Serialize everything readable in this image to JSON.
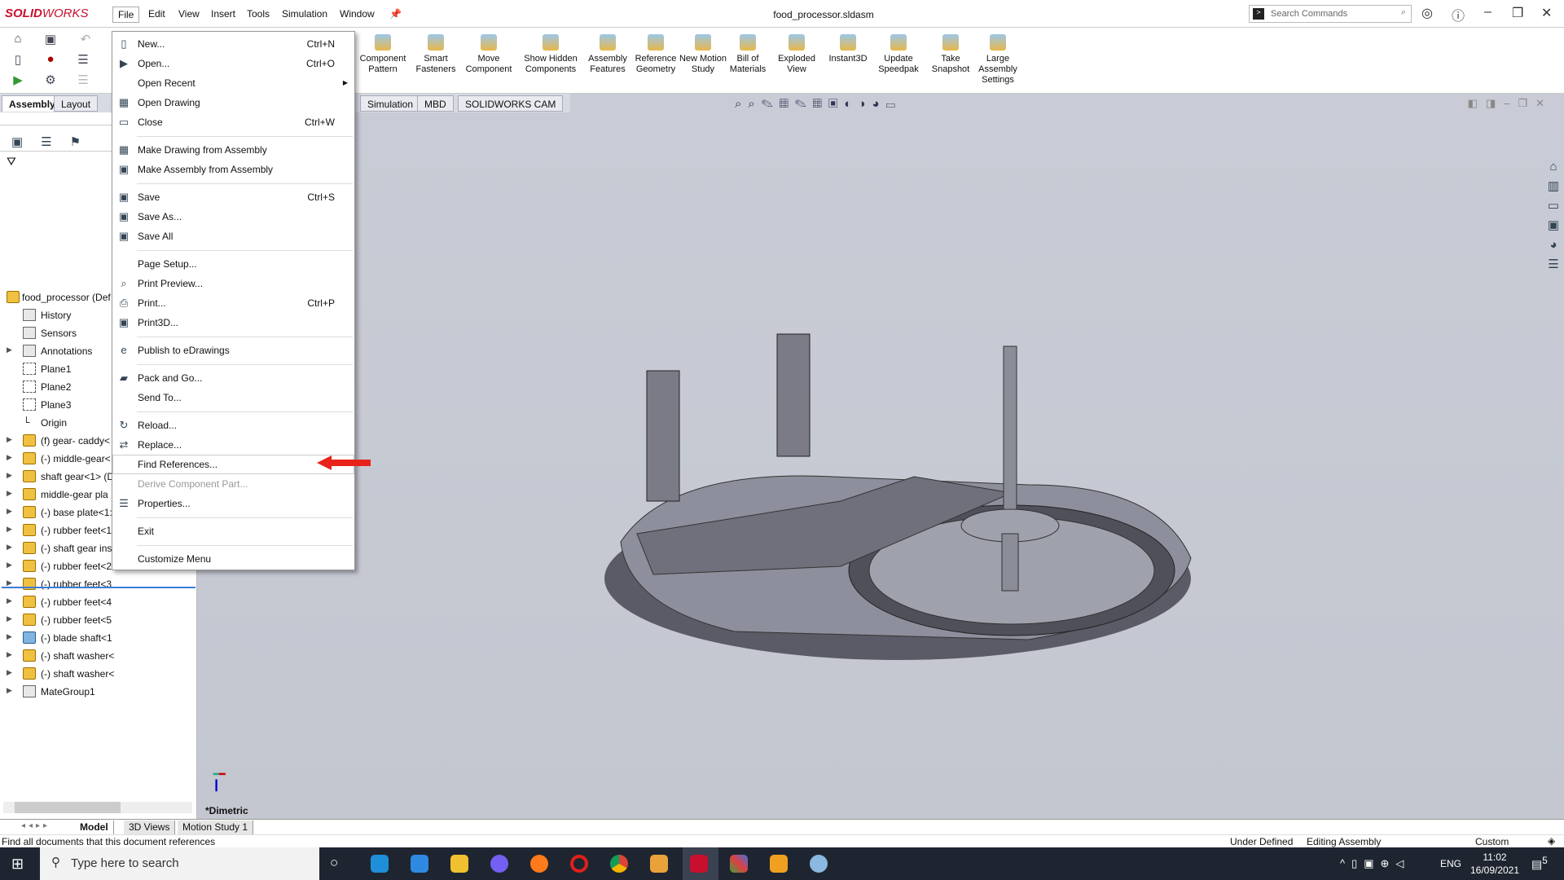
{
  "app": {
    "brand_bold": "SOLID",
    "brand_light": "WORKS",
    "document_title": "food_processor.sldasm"
  },
  "menubar": [
    "File",
    "Edit",
    "View",
    "Insert",
    "Tools",
    "Simulation",
    "Window"
  ],
  "search": {
    "placeholder": "Search Commands"
  },
  "toolbar": [
    {
      "label": "Component Pattern",
      "icon": "component-pattern-icon"
    },
    {
      "label": "Smart Fasteners",
      "icon": "smart-fasteners-icon"
    },
    {
      "label": "Move Component",
      "icon": "move-component-icon"
    },
    {
      "label": "Show Hidden Components",
      "icon": "show-hidden-icon"
    },
    {
      "label": "Assembly Features",
      "icon": "assembly-features-icon"
    },
    {
      "label": "Reference Geometry",
      "icon": "reference-geometry-icon"
    },
    {
      "label": "New Motion Study",
      "icon": "motion-study-icon"
    },
    {
      "label": "Bill of Materials",
      "icon": "bom-icon"
    },
    {
      "label": "Exploded View",
      "icon": "exploded-view-icon"
    },
    {
      "label": "Instant3D",
      "icon": "instant3d-icon"
    },
    {
      "label": "Update Speedpak",
      "icon": "speedpak-icon"
    },
    {
      "label": "Take Snapshot",
      "icon": "snapshot-icon"
    },
    {
      "label": "Large Assembly Settings",
      "icon": "large-assembly-icon"
    }
  ],
  "command_tabs": [
    "Assembly",
    "Layout",
    "Simulation",
    "MBD",
    "SOLIDWORKS CAM"
  ],
  "tree": [
    {
      "label": "food_processor  (Def",
      "type": "assembly"
    },
    {
      "label": "History",
      "type": "folder"
    },
    {
      "label": "Sensors",
      "type": "folder"
    },
    {
      "label": "Annotations",
      "type": "folder",
      "expand": true
    },
    {
      "label": "Plane1",
      "type": "plane"
    },
    {
      "label": "Plane2",
      "type": "plane"
    },
    {
      "label": "Plane3",
      "type": "plane"
    },
    {
      "label": "Origin",
      "type": "origin"
    },
    {
      "label": "(f) gear- caddy<",
      "type": "part",
      "expand": true
    },
    {
      "label": "(-) middle-gear<",
      "type": "part",
      "expand": true
    },
    {
      "label": "shaft gear<1> (D",
      "type": "part",
      "expand": true
    },
    {
      "label": "middle-gear pla",
      "type": "part",
      "expand": true
    },
    {
      "label": "(-) base plate<1:",
      "type": "part",
      "expand": true
    },
    {
      "label": "(-) rubber feet<1",
      "type": "part",
      "expand": true
    },
    {
      "label": "(-) shaft gear ins",
      "type": "part",
      "expand": true
    },
    {
      "label": "(-) rubber feet<2",
      "type": "part",
      "expand": true
    },
    {
      "label": "(-) rubber feet<3",
      "type": "part",
      "expand": true
    },
    {
      "label": "(-) rubber feet<4",
      "type": "part",
      "expand": true
    },
    {
      "label": "(-) rubber feet<5",
      "type": "part",
      "expand": true
    },
    {
      "label": "(-) blade shaft<1",
      "type": "blue",
      "expand": true
    },
    {
      "label": "(-) shaft washer<",
      "type": "part",
      "expand": true
    },
    {
      "label": "(-) shaft washer<",
      "type": "part",
      "expand": true
    },
    {
      "label": "MateGroup1",
      "type": "mate",
      "expand": true
    }
  ],
  "file_menu": [
    {
      "label": "New...",
      "shortcut": "Ctrl+N",
      "icon": "new-document-icon"
    },
    {
      "label": "Open...",
      "shortcut": "Ctrl+O",
      "icon": "open-folder-icon"
    },
    {
      "label": "Open Recent",
      "submenu": true
    },
    {
      "label": "Open Drawing",
      "icon": "open-drawing-icon"
    },
    {
      "label": "Close",
      "shortcut": "Ctrl+W",
      "icon": "close-document-icon",
      "sep": true
    },
    {
      "label": "Make Drawing from Assembly",
      "icon": "make-drawing-icon"
    },
    {
      "label": "Make Assembly from Assembly",
      "icon": "make-assembly-icon",
      "sep": true
    },
    {
      "label": "Save",
      "shortcut": "Ctrl+S",
      "icon": "save-icon"
    },
    {
      "label": "Save As...",
      "icon": "save-as-icon"
    },
    {
      "label": "Save All",
      "icon": "save-all-icon",
      "sep": true
    },
    {
      "label": "Page Setup..."
    },
    {
      "label": "Print Preview...",
      "icon": "print-preview-icon"
    },
    {
      "label": "Print...",
      "shortcut": "Ctrl+P",
      "icon": "printer-icon"
    },
    {
      "label": "Print3D...",
      "icon": "print3d-icon",
      "sep": true
    },
    {
      "label": "Publish to eDrawings",
      "icon": "edrawings-icon",
      "sep": true
    },
    {
      "label": "Pack and Go...",
      "icon": "pack-and-go-icon"
    },
    {
      "label": "Send To...",
      "sep": true
    },
    {
      "label": "Reload...",
      "icon": "reload-icon"
    },
    {
      "label": "Replace...",
      "icon": "replace-icon"
    },
    {
      "label": "Find References...",
      "highlighted": true
    },
    {
      "label": "Derive Component Part...",
      "disabled": true
    },
    {
      "label": "Properties...",
      "icon": "properties-icon",
      "sep": true
    },
    {
      "label": "Exit",
      "sep": true
    },
    {
      "label": "Customize Menu"
    }
  ],
  "viewport": {
    "view_name": "*Dimetric"
  },
  "bottom_tabs": [
    "Model",
    "3D Views",
    "Motion Study 1"
  ],
  "status": {
    "message": "Find all documents that this document references",
    "state": "Under Defined",
    "mode": "Editing Assembly",
    "units": "Custom"
  },
  "taskbar": {
    "search_placeholder": "Type here to search",
    "language": "ENG",
    "time": "11:02",
    "date": "16/09/2021",
    "notifications": "5"
  },
  "colors": {
    "brand": "#c8102e",
    "viewport": "#c7cad3",
    "arrow": "#e8231a"
  }
}
